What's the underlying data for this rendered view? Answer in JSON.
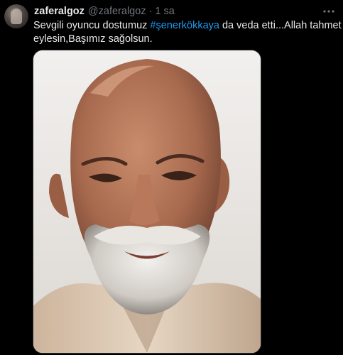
{
  "author": {
    "display_name": "zaferalgoz",
    "handle": "@zaferalgoz",
    "separator": "·",
    "timestamp": "1 sa"
  },
  "tweet": {
    "text_before_hashtag": "Sevgili oyuncu dostumuz ",
    "hashtag": "#şenerkökkaya",
    "text_after_hashtag": " da veda etti...Allah tahmet",
    "second_line": "eylesin,Başımız sağolsun."
  },
  "colors": {
    "background": "#000000",
    "text": "#e7e9ea",
    "secondary_text": "#71767b",
    "link": "#1d9bf0",
    "border": "#2f3336"
  },
  "icons": {
    "more": "more-dots-icon"
  }
}
